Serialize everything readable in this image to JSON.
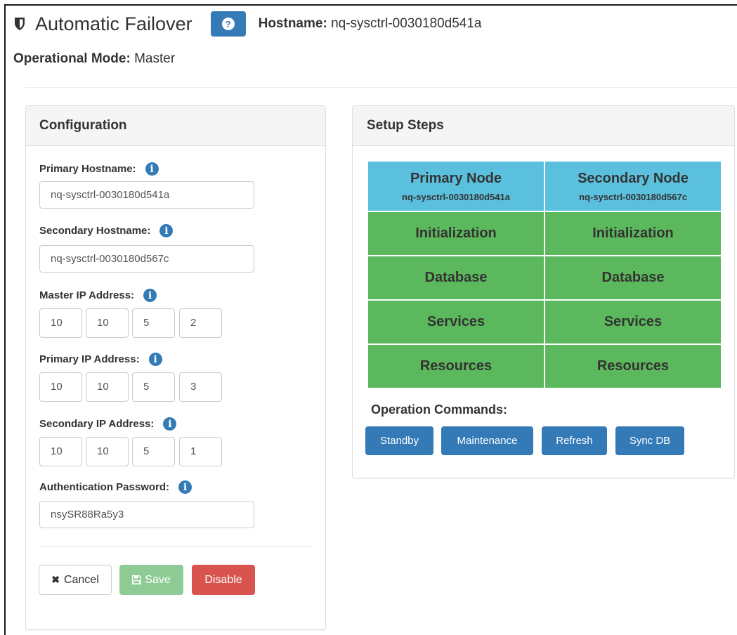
{
  "header": {
    "title": "Automatic Failover",
    "help_label": "?",
    "hostname_label": "Hostname:",
    "hostname_value": "nq-sysctrl-0030180d541a",
    "mode_label": "Operational Mode:",
    "mode_value": "Master"
  },
  "configuration": {
    "title": "Configuration",
    "primary_hostname": {
      "label": "Primary Hostname:",
      "value": "nq-sysctrl-0030180d541a"
    },
    "secondary_hostname": {
      "label": "Secondary Hostname:",
      "value": "nq-sysctrl-0030180d567c"
    },
    "master_ip": {
      "label": "Master IP Address:",
      "octets": [
        "10",
        "10",
        "5",
        "2"
      ]
    },
    "primary_ip": {
      "label": "Primary IP Address:",
      "octets": [
        "10",
        "10",
        "5",
        "3"
      ]
    },
    "secondary_ip": {
      "label": "Secondary IP Address:",
      "octets": [
        "10",
        "10",
        "5",
        "1"
      ]
    },
    "auth_password": {
      "label": "Authentication Password:",
      "value": "nsySR88Ra5y3"
    },
    "buttons": {
      "cancel": "Cancel",
      "save": "Save",
      "disable": "Disable"
    }
  },
  "setup_steps": {
    "title": "Setup Steps",
    "primary_node": {
      "title": "Primary Node",
      "hostname": "nq-sysctrl-0030180d541a"
    },
    "secondary_node": {
      "title": "Secondary Node",
      "hostname": "nq-sysctrl-0030180d567c"
    },
    "steps": [
      "Initialization",
      "Database",
      "Services",
      "Resources"
    ],
    "operation_commands_label": "Operation Commands:",
    "commands": [
      "Standby",
      "Maintenance",
      "Refresh",
      "Sync DB"
    ]
  },
  "colors": {
    "primary": "#337ab7",
    "info_header": "#5bc0de",
    "step_complete": "#5cb85c",
    "danger": "#d9534f",
    "save_disabled": "#8fcc95"
  },
  "icons": [
    "shield-icon",
    "question-icon",
    "info-icon",
    "times-icon",
    "floppy-icon"
  ]
}
